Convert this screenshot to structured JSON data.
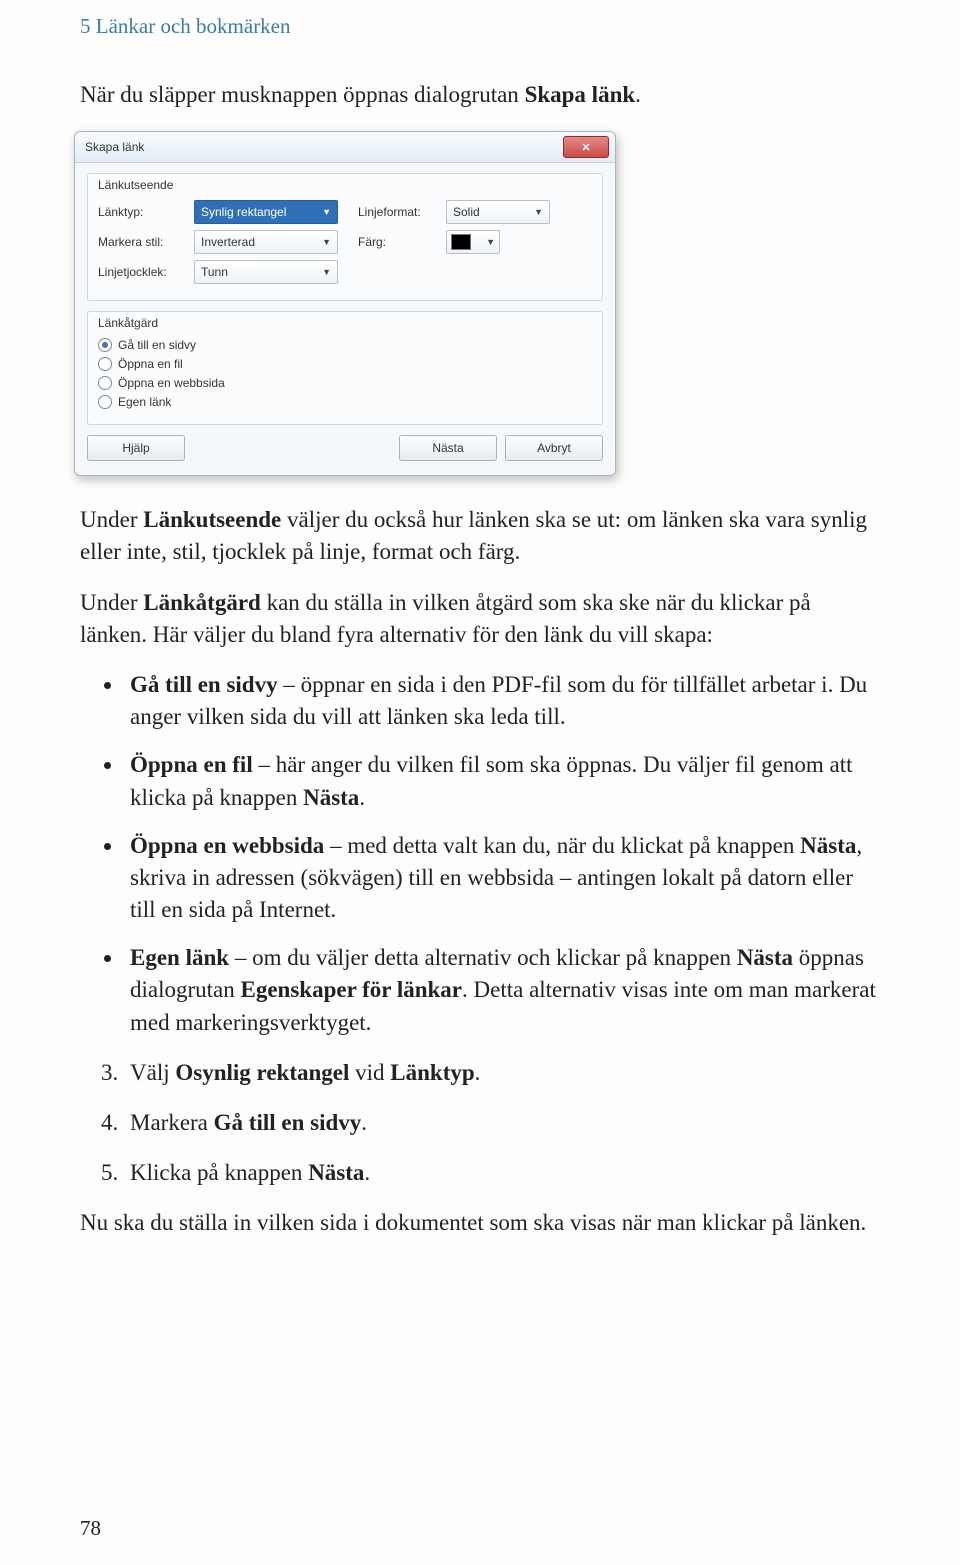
{
  "chapter": "5 Länkar och bokmärken",
  "intro_before": "När du släpper musknappen öppnas dialogrutan ",
  "intro_bold": "Skapa länk",
  "intro_after": ".",
  "dialog": {
    "title": "Skapa länk",
    "group1_title": "Länkutseende",
    "linktype_lbl": "Länktyp:",
    "linktype_val": "Synlig rektangel",
    "lineformat_lbl": "Linjeformat:",
    "lineformat_val": "Solid",
    "highlight_lbl": "Markera stil:",
    "highlight_val": "Inverterad",
    "color_lbl": "Färg:",
    "thickness_lbl": "Linjetjocklek:",
    "thickness_val": "Tunn",
    "group2_title": "Länkåtgärd",
    "opt1": "Gå till en sidvy",
    "opt2": "Öppna en fil",
    "opt3": "Öppna en webbsida",
    "opt4": "Egen länk",
    "help": "Hjälp",
    "next": "Nästa",
    "cancel": "Avbryt"
  },
  "para1_a": "Under ",
  "para1_b": "Länkutseende",
  "para1_c": " väljer du också hur länken ska se ut: om länken ska vara synlig eller inte, stil, tjocklek på linje, format och färg.",
  "para2_a": "Under ",
  "para2_b": "Länkåtgärd",
  "para2_c": " kan du ställa in vilken åtgärd som ska ske när du klickar på länken. Här väljer du bland fyra alternativ för den länk du vill skapa:",
  "b1_b": "Gå till en sidvy",
  "b1_t": " – öppnar en sida i den PDF-fil som du för tillfället arbetar i. Du anger vilken sida du vill att länken ska leda till.",
  "b2_b": "Öppna en fil",
  "b2_t1": " – här anger du vilken fil som ska öppnas. Du väljer fil genom att klicka på knappen ",
  "b2_b2": "Nästa",
  "b2_t2": ".",
  "b3_b": "Öppna en webbsida",
  "b3_t1": " – med detta valt kan du, när du klickat på knappen ",
  "b3_b2": "Nästa",
  "b3_t2": ", skriva in adressen (sökvägen) till en webbsida – antingen lokalt på datorn eller till en sida på Internet.",
  "b4_b": "Egen länk",
  "b4_t1": " – om du väljer detta alternativ och klickar på knappen ",
  "b4_b2": "Nästa",
  "b4_t2": " öppnas dialogrutan ",
  "b4_b3": "Egenskaper för länkar",
  "b4_t3": ". Detta alternativ visas inte om man markerat med markeringsverktyget.",
  "s3_a": "Välj ",
  "s3_b": "Osynlig rektangel",
  "s3_c": " vid ",
  "s3_d": "Länktyp",
  "s3_e": ".",
  "s4_a": "Markera ",
  "s4_b": "Gå till en sidvy",
  "s4_c": ".",
  "s5_a": "Klicka på knappen ",
  "s5_b": "Nästa",
  "s5_c": ".",
  "closing": "Nu ska du ställa in vilken sida i dokumentet som ska visas när man klickar på länken.",
  "page_num": "78"
}
